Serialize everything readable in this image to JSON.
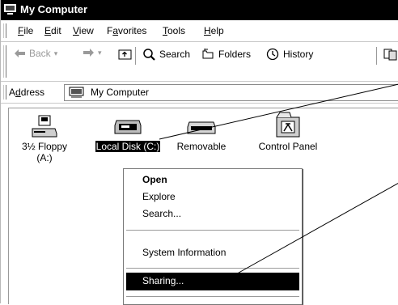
{
  "window": {
    "title": "My Computer"
  },
  "menu": {
    "items": [
      {
        "label": "File",
        "u": "F",
        "rest": "ile"
      },
      {
        "label": "Edit",
        "u": "E",
        "rest": "dit"
      },
      {
        "label": "View",
        "u": "V",
        "rest": "iew"
      },
      {
        "label": "Favorites",
        "pre": "F",
        "u": "a",
        "rest": "vorites"
      },
      {
        "label": "Tools",
        "u": "T",
        "rest": "ools"
      },
      {
        "label": "Help",
        "u": "H",
        "rest": "elp"
      }
    ]
  },
  "toolbar": {
    "back_label": "Back",
    "search_label": "Search",
    "folders_label": "Folders",
    "history_label": "History"
  },
  "address": {
    "label_pre": "A",
    "label_u": "d",
    "label_rest": "dress",
    "value": "My Computer"
  },
  "content": {
    "items": [
      {
        "name": "3½ Floppy",
        "line2": "(A:)",
        "icon": "floppy-drive-icon"
      },
      {
        "name": "Local Disk (C:)",
        "icon": "hard-disk-icon",
        "selected": true
      },
      {
        "name": "Removable",
        "icon": "removable-drive-icon"
      },
      {
        "name": "Control Panel",
        "icon": "control-panel-icon"
      }
    ]
  },
  "context_menu": {
    "open": "Open",
    "explore": "Explore",
    "search": "Search...",
    "system_info": "System Information",
    "sharing": "Sharing..."
  },
  "colors": {
    "titlebar": "#000000",
    "selection": "#000000",
    "background": "#ffffff"
  }
}
